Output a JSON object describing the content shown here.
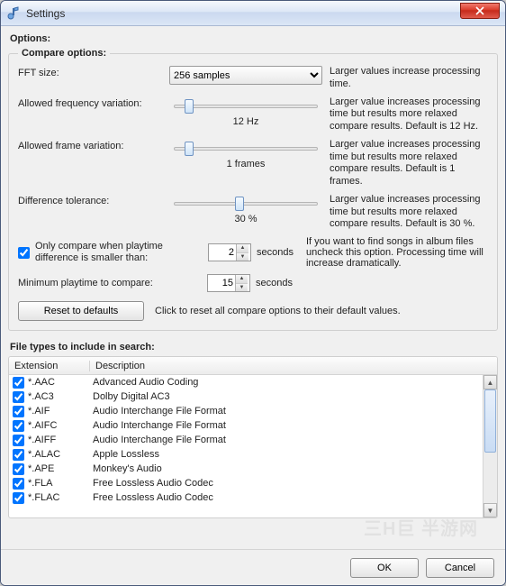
{
  "window": {
    "title": "Settings"
  },
  "options_label": "Options:",
  "compare": {
    "legend": "Compare options:",
    "fft": {
      "label": "FFT size:",
      "selected": "256 samples",
      "help": "Larger values increase processing time."
    },
    "freq": {
      "label": "Allowed frequency variation:",
      "value_text": "12 Hz",
      "slider_pct": 8,
      "help": "Larger value increases processing time but results more relaxed compare results. Default is 12 Hz."
    },
    "frame": {
      "label": "Allowed frame variation:",
      "value_text": "1 frames",
      "slider_pct": 8,
      "help": "Larger value increases processing time but results more relaxed compare results. Default is 1 frames."
    },
    "diff": {
      "label": "Difference tolerance:",
      "value_text": "30 %",
      "slider_pct": 45,
      "help": "Larger value increases processing time but results more relaxed compare results. Default is 30 %."
    },
    "only_compare": {
      "checked": true,
      "label": "Only compare when playtime difference is smaller than:",
      "value": "2",
      "unit": "seconds",
      "help": "If you want to find songs in album files uncheck this option. Processing time will increase dramatically."
    },
    "min_playtime": {
      "label": "Minimum playtime to compare:",
      "value": "15",
      "unit": "seconds"
    },
    "reset": {
      "button": "Reset to defaults",
      "text": "Click to reset all compare options to their default values."
    }
  },
  "filetypes": {
    "legend": "File types to include in search:",
    "col_ext": "Extension",
    "col_desc": "Description",
    "rows": [
      {
        "checked": true,
        "ext": "*.AAC",
        "desc": "Advanced Audio Coding"
      },
      {
        "checked": true,
        "ext": "*.AC3",
        "desc": "Dolby Digital AC3"
      },
      {
        "checked": true,
        "ext": "*.AIF",
        "desc": "Audio Interchange File Format"
      },
      {
        "checked": true,
        "ext": "*.AIFC",
        "desc": "Audio Interchange File Format"
      },
      {
        "checked": true,
        "ext": "*.AIFF",
        "desc": "Audio Interchange File Format"
      },
      {
        "checked": true,
        "ext": "*.ALAC",
        "desc": "Apple Lossless"
      },
      {
        "checked": true,
        "ext": "*.APE",
        "desc": "Monkey's Audio"
      },
      {
        "checked": true,
        "ext": "*.FLA",
        "desc": "Free Lossless Audio Codec"
      },
      {
        "checked": true,
        "ext": "*.FLAC",
        "desc": "Free Lossless Audio Codec"
      }
    ]
  },
  "buttons": {
    "ok": "OK",
    "cancel": "Cancel"
  }
}
